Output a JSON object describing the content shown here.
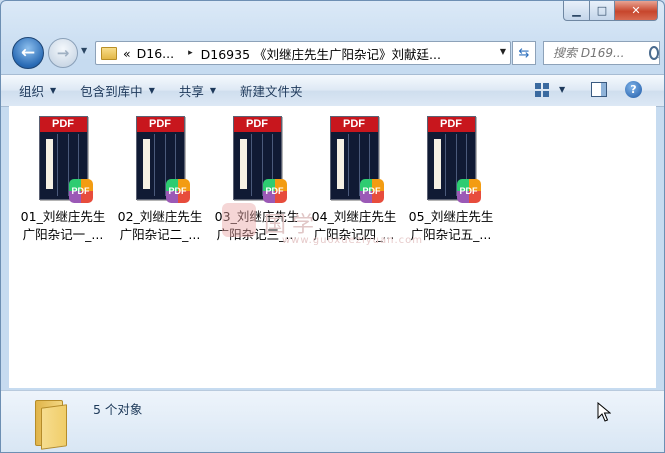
{
  "window": {
    "caption": {
      "minimize": "▁",
      "maximize": "□",
      "close": "✕"
    }
  },
  "nav": {
    "back_glyph": "←",
    "forward_glyph": "→",
    "address": {
      "overflow_glyph": "«",
      "segments": [
        "D16...",
        "D16935 《刘继庄先生广阳杂记》刘献廷..."
      ],
      "separator": "▸"
    },
    "refresh_glyph": "⇆",
    "search_placeholder": "搜索 D169..."
  },
  "toolbar": {
    "organize": "组织",
    "include_in_library": "包含到库中",
    "share": "共享",
    "new_folder": "新建文件夹",
    "help": "?"
  },
  "files": [
    {
      "line1": "01_刘继庄先生",
      "line2": "广阳杂记一_...",
      "badge": "PDF",
      "app": "PDF"
    },
    {
      "line1": "02_刘继庄先生",
      "line2": "广阳杂记二_...",
      "badge": "PDF",
      "app": "PDF"
    },
    {
      "line1": "03_刘继庄先生",
      "line2": "广阳杂记三_...",
      "badge": "PDF",
      "app": "PDF"
    },
    {
      "line1": "04_刘继庄先生",
      "line2": "广阳杂记四_...",
      "badge": "PDF",
      "app": "PDF"
    },
    {
      "line1": "05_刘继庄先生",
      "line2": "广阳杂记五_...",
      "badge": "PDF",
      "app": "PDF"
    }
  ],
  "watermark": {
    "text": "国学",
    "url": "www.guoxueziyuan.com"
  },
  "details": {
    "count": "5 个对象"
  },
  "colors": {
    "window_frame": "#c6dbf0",
    "pdf_red": "#c8161d",
    "book_cover": "#101a34",
    "close_red": "#c7462c"
  }
}
